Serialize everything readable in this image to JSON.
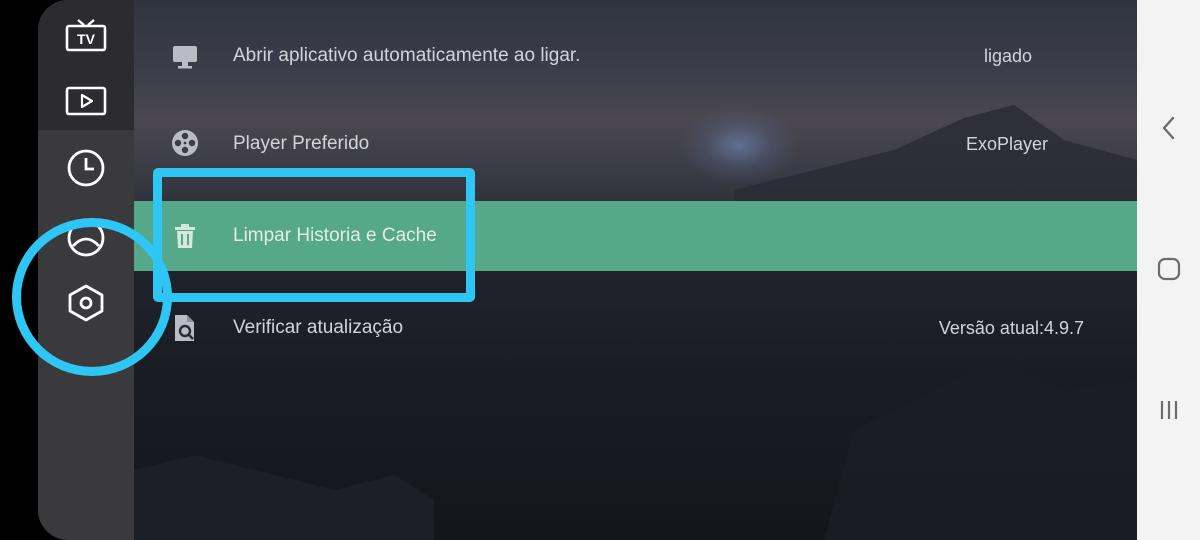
{
  "sidebar": {
    "items": [
      {
        "icon": "tv-icon"
      },
      {
        "icon": "play-icon"
      },
      {
        "icon": "clock-icon"
      },
      {
        "icon": "user-icon"
      },
      {
        "icon": "settings-icon",
        "selected": true
      }
    ]
  },
  "settings": {
    "rows": [
      {
        "icon": "monitor-icon",
        "label": "Abrir aplicativo automaticamente ao ligar.",
        "value": "ligado"
      },
      {
        "icon": "film-reel-icon",
        "label": "Player Preferido",
        "value": "ExoPlayer"
      },
      {
        "icon": "trash-icon",
        "label": "Limpar Historia e Cache",
        "value": ""
      },
      {
        "icon": "update-search-icon",
        "label": "Verificar atualização",
        "value": "Versão atual:4.9.7"
      }
    ]
  },
  "tv_icon_text": "TV",
  "colors": {
    "highlight_row": "#56a88a",
    "annotation": "#2ec6f4",
    "sidebar": "#3a3a3c",
    "navbar": "#f3f3f4"
  },
  "navbar": {
    "buttons": [
      "back-icon",
      "home-icon",
      "recents-icon"
    ]
  }
}
